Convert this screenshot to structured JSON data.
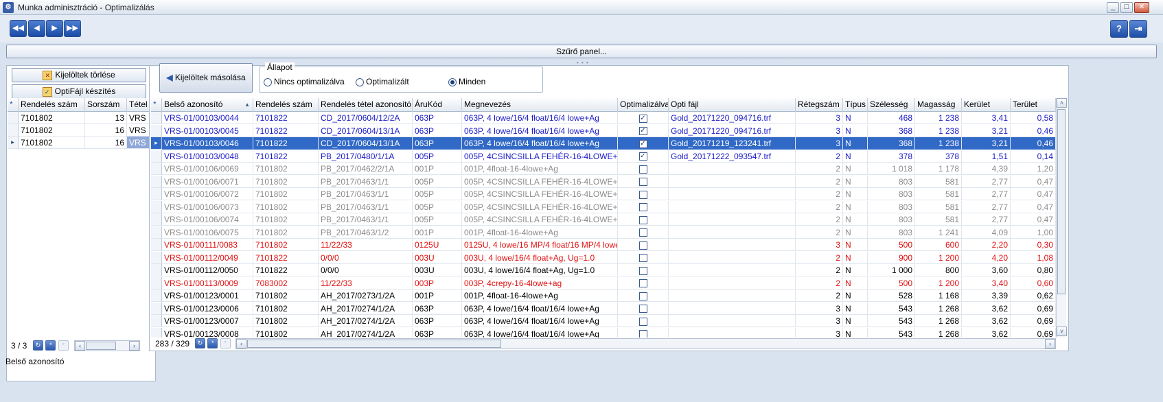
{
  "window": {
    "title": "Munka adminisztráció - Optimalizálás"
  },
  "toolbar": {
    "nav": [
      {
        "icon": "first-icon",
        "glyph": "◀◀"
      },
      {
        "icon": "prev-icon",
        "glyph": "◀"
      },
      {
        "icon": "next-icon",
        "glyph": "▶"
      },
      {
        "icon": "last-icon",
        "glyph": "▶▶"
      }
    ],
    "help_glyph": "?",
    "exit_glyph": "⇥"
  },
  "filter_panel": {
    "label": "Szűrő panel..."
  },
  "left": {
    "delete_label": "Kijelöltek törlése",
    "optifile_label": "OptiFájl készítés",
    "columns": [
      "Rendelés szám",
      "Sorszám",
      "Tétel"
    ],
    "rows": [
      {
        "rendeles": "7101802",
        "sorszam": "13",
        "tetel": "VRS"
      },
      {
        "rendeles": "7101802",
        "sorszam": "16",
        "tetel": "VRS"
      },
      {
        "rendeles": "7101802",
        "sorszam": "16",
        "tetel": "VRS"
      }
    ],
    "counter": "3 / 3"
  },
  "main": {
    "copy_label": "Kijelöltek másolása",
    "status": {
      "legend": "Állapot",
      "options": [
        "Nincs optimalizálva",
        "Optimalizált",
        "Minden"
      ],
      "selected": "Minden"
    },
    "columns": [
      "Belső azonosító",
      "Rendelés szám",
      "Rendelés tétel azonosító",
      "ÁruKód",
      "Megnevezés",
      "Optimalizálva",
      "Opti fájl",
      "Rétegszám",
      "Típus",
      "Szélesség",
      "Magasság",
      "Kerület",
      "Terület"
    ],
    "rows": [
      {
        "id": "VRS-01/00103/0044",
        "rendeles": "7101822",
        "tetel": "CD_2017/0604/12/2A",
        "aru": "063P",
        "megnev": "063P, 4 lowe/16/4 float/16/4 lowe+Ag",
        "opt": true,
        "fajl": "Gold_20171220_094716.trf",
        "reteg": "3",
        "tipus": "N",
        "szel": "468",
        "mag": "1 238",
        "ker": "3,41",
        "ter": "0,58",
        "color": "blue"
      },
      {
        "id": "VRS-01/00103/0045",
        "rendeles": "7101822",
        "tetel": "CD_2017/0604/13/1A",
        "aru": "063P",
        "megnev": "063P, 4 lowe/16/4 float/16/4 lowe+Ag",
        "opt": true,
        "fajl": "Gold_20171220_094716.trf",
        "reteg": "3",
        "tipus": "N",
        "szel": "368",
        "mag": "1 238",
        "ker": "3,21",
        "ter": "0,46",
        "color": "blue"
      },
      {
        "id": "VRS-01/00103/0046",
        "rendeles": "7101822",
        "tetel": "CD_2017/0604/13/1A",
        "aru": "063P",
        "megnev": "063P, 4 lowe/16/4 float/16/4 lowe+Ag",
        "opt": true,
        "fajl": "Gold_20171219_123241.trf",
        "reteg": "3",
        "tipus": "N",
        "szel": "368",
        "mag": "1 238",
        "ker": "3,21",
        "ter": "0,46",
        "color": "blue",
        "selected": true
      },
      {
        "id": "VRS-01/00103/0048",
        "rendeles": "7101822",
        "tetel": "PB_2017/0480/1/1A",
        "aru": "005P",
        "megnev": "005P, 4CSINCSILLA FEHÉR-16-4LOWE+AG",
        "opt": true,
        "fajl": "Gold_20171222_093547.trf",
        "reteg": "2",
        "tipus": "N",
        "szel": "378",
        "mag": "378",
        "ker": "1,51",
        "ter": "0,14",
        "color": "blue"
      },
      {
        "id": "VRS-01/00106/0069",
        "rendeles": "7101802",
        "tetel": "PB_2017/0462/2/1A",
        "aru": "001P",
        "megnev": "001P, 4float-16-4lowe+Ag",
        "opt": false,
        "fajl": "",
        "reteg": "2",
        "tipus": "N",
        "szel": "1 018",
        "mag": "1 178",
        "ker": "4,39",
        "ter": "1,20",
        "color": "gray"
      },
      {
        "id": "VRS-01/00106/0071",
        "rendeles": "7101802",
        "tetel": "PB_2017/0463/1/1",
        "aru": "005P",
        "megnev": "005P, 4CSINCSILLA FEHÉR-16-4LOWE+AG",
        "opt": false,
        "fajl": "",
        "reteg": "2",
        "tipus": "N",
        "szel": "803",
        "mag": "581",
        "ker": "2,77",
        "ter": "0,47",
        "color": "gray"
      },
      {
        "id": "VRS-01/00106/0072",
        "rendeles": "7101802",
        "tetel": "PB_2017/0463/1/1",
        "aru": "005P",
        "megnev": "005P, 4CSINCSILLA FEHÉR-16-4LOWE+AG",
        "opt": false,
        "fajl": "",
        "reteg": "2",
        "tipus": "N",
        "szel": "803",
        "mag": "581",
        "ker": "2,77",
        "ter": "0,47",
        "color": "gray"
      },
      {
        "id": "VRS-01/00106/0073",
        "rendeles": "7101802",
        "tetel": "PB_2017/0463/1/1",
        "aru": "005P",
        "megnev": "005P, 4CSINCSILLA FEHÉR-16-4LOWE+AG",
        "opt": false,
        "fajl": "",
        "reteg": "2",
        "tipus": "N",
        "szel": "803",
        "mag": "581",
        "ker": "2,77",
        "ter": "0,47",
        "color": "gray"
      },
      {
        "id": "VRS-01/00106/0074",
        "rendeles": "7101802",
        "tetel": "PB_2017/0463/1/1",
        "aru": "005P",
        "megnev": "005P, 4CSINCSILLA FEHÉR-16-4LOWE+AG",
        "opt": false,
        "fajl": "",
        "reteg": "2",
        "tipus": "N",
        "szel": "803",
        "mag": "581",
        "ker": "2,77",
        "ter": "0,47",
        "color": "gray"
      },
      {
        "id": "VRS-01/00106/0075",
        "rendeles": "7101802",
        "tetel": "PB_2017/0463/1/2",
        "aru": "001P",
        "megnev": "001P, 4float-16-4lowe+Ag",
        "opt": false,
        "fajl": "",
        "reteg": "2",
        "tipus": "N",
        "szel": "803",
        "mag": "1 241",
        "ker": "4,09",
        "ter": "1,00",
        "color": "gray"
      },
      {
        "id": "VRS-01/00111/0083",
        "rendeles": "7101802",
        "tetel": "11/22/33",
        "aru": "0125U",
        "megnev": "0125U, 4 lowe/16 MP/4 float/16 MP/4 lowe",
        "opt": false,
        "fajl": "",
        "reteg": "3",
        "tipus": "N",
        "szel": "500",
        "mag": "600",
        "ker": "2,20",
        "ter": "0,30",
        "color": "red"
      },
      {
        "id": "VRS-01/00112/0049",
        "rendeles": "7101822",
        "tetel": "0/0/0",
        "aru": "003U",
        "megnev": "003U, 4 lowe/16/4 float+Ag, Ug=1.0",
        "opt": false,
        "fajl": "",
        "reteg": "2",
        "tipus": "N",
        "szel": "900",
        "mag": "1 200",
        "ker": "4,20",
        "ter": "1,08",
        "color": "red"
      },
      {
        "id": "VRS-01/00112/0050",
        "rendeles": "7101822",
        "tetel": "0/0/0",
        "aru": "003U",
        "megnev": "003U, 4 lowe/16/4 float+Ag, Ug=1.0",
        "opt": false,
        "fajl": "",
        "reteg": "2",
        "tipus": "N",
        "szel": "1 000",
        "mag": "800",
        "ker": "3,60",
        "ter": "0,80",
        "color": "black"
      },
      {
        "id": "VRS-01/00113/0009",
        "rendeles": "7083002",
        "tetel": "11/22/33",
        "aru": "003P",
        "megnev": "003P, 4crepy-16-4lowe+ag",
        "opt": false,
        "fajl": "",
        "reteg": "2",
        "tipus": "N",
        "szel": "500",
        "mag": "1 200",
        "ker": "3,40",
        "ter": "0,60",
        "color": "red"
      },
      {
        "id": "VRS-01/00123/0001",
        "rendeles": "7101802",
        "tetel": "AH_2017/0273/1/2A",
        "aru": "001P",
        "megnev": "001P, 4float-16-4lowe+Ag",
        "opt": false,
        "fajl": "",
        "reteg": "2",
        "tipus": "N",
        "szel": "528",
        "mag": "1 168",
        "ker": "3,39",
        "ter": "0,62",
        "color": "black"
      },
      {
        "id": "VRS-01/00123/0006",
        "rendeles": "7101802",
        "tetel": "AH_2017/0274/1/2A",
        "aru": "063P",
        "megnev": "063P, 4 lowe/16/4 float/16/4 lowe+Ag",
        "opt": false,
        "fajl": "",
        "reteg": "3",
        "tipus": "N",
        "szel": "543",
        "mag": "1 268",
        "ker": "3,62",
        "ter": "0,69",
        "color": "black"
      },
      {
        "id": "VRS-01/00123/0007",
        "rendeles": "7101802",
        "tetel": "AH_2017/0274/1/2A",
        "aru": "063P",
        "megnev": "063P, 4 lowe/16/4 float/16/4 lowe+Ag",
        "opt": false,
        "fajl": "",
        "reteg": "3",
        "tipus": "N",
        "szel": "543",
        "mag": "1 268",
        "ker": "3,62",
        "ter": "0,69",
        "color": "black"
      },
      {
        "id": "VRS-01/00123/0008",
        "rendeles": "7101802",
        "tetel": "AH_2017/0274/1/2A",
        "aru": "063P",
        "megnev": "063P, 4 lowe/16/4 float/16/4 lowe+Ag",
        "opt": false,
        "fajl": "",
        "reteg": "3",
        "tipus": "N",
        "szel": "543",
        "mag": "1 268",
        "ker": "3,62",
        "ter": "0,69",
        "color": "black"
      }
    ],
    "counter": "283 / 329"
  },
  "statusline": "Belső azonosító"
}
